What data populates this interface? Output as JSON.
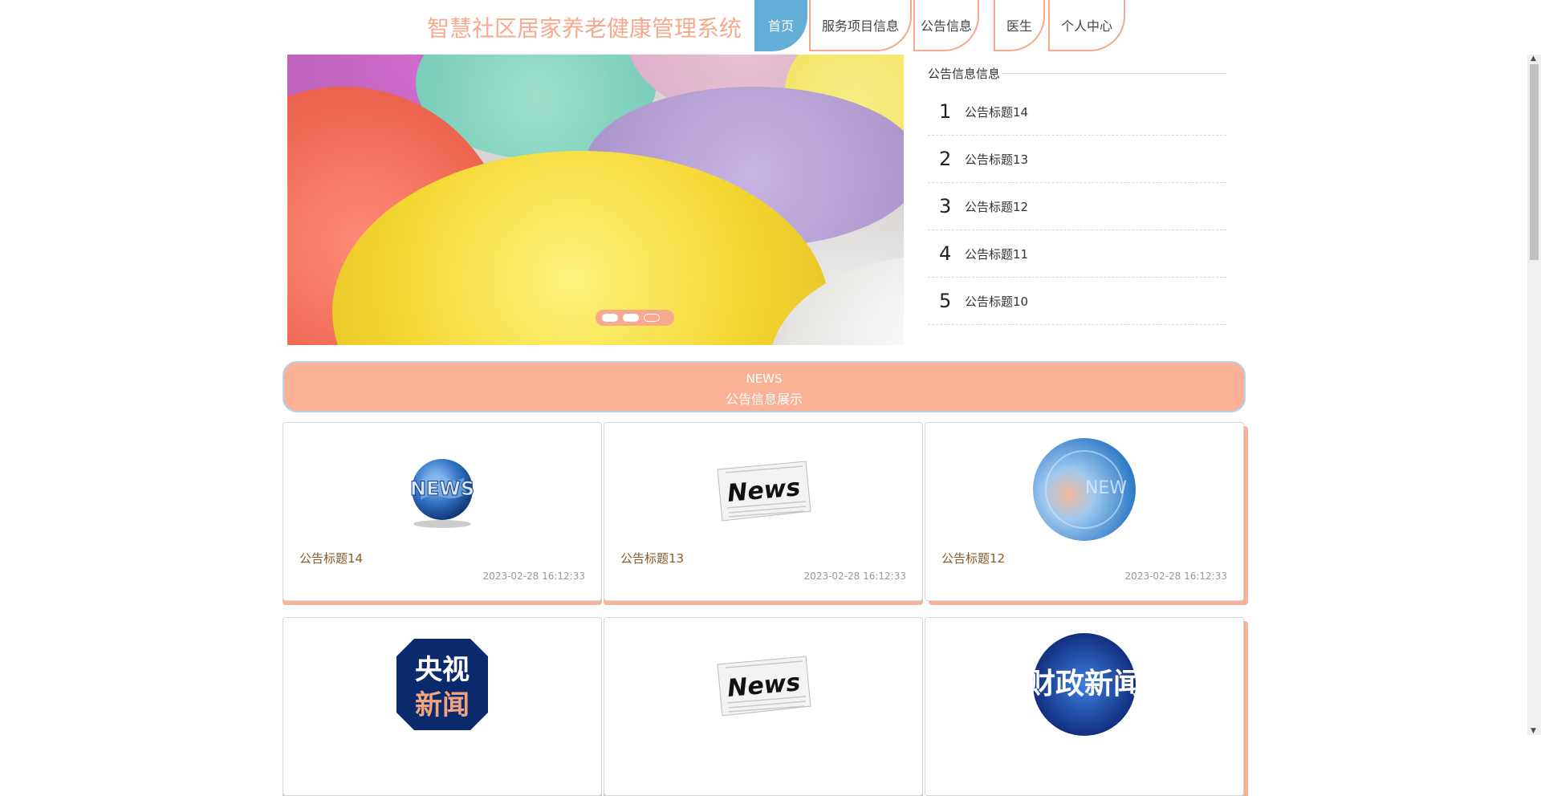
{
  "header": {
    "site_title": "智慧社区居家养老健康管理系统",
    "nav": [
      {
        "label": "首页",
        "active": true
      },
      {
        "label": "服务项目信息",
        "active": false
      },
      {
        "label": "公告信息",
        "active": false
      },
      {
        "label": "医生",
        "active": false
      },
      {
        "label": "个人中心",
        "active": false
      }
    ]
  },
  "carousel": {
    "image_desc": "colorful-eggs-photo",
    "slides": 3,
    "active_slide": 3
  },
  "notice_panel": {
    "heading": "公告信息信息",
    "items": [
      {
        "num": "1",
        "title": "公告标题14"
      },
      {
        "num": "2",
        "title": "公告标题13"
      },
      {
        "num": "3",
        "title": "公告标题12"
      },
      {
        "num": "4",
        "title": "公告标题11"
      },
      {
        "num": "5",
        "title": "公告标题10"
      }
    ]
  },
  "news_banner": {
    "en": "NEWS",
    "cn": "公告信息展示"
  },
  "news_cards": [
    {
      "title": "公告标题14",
      "date": "2023-02-28 16:12:33",
      "icon": "globe-news-icon"
    },
    {
      "title": "公告标题13",
      "date": "2023-02-28 16:12:33",
      "icon": "newspaper-icon"
    },
    {
      "title": "公告标题12",
      "date": "2023-02-28 16:12:33",
      "icon": "digital-globe-icon"
    },
    {
      "title": "",
      "date": "",
      "icon": "cctv-news-logo",
      "logo_text": [
        "央视",
        "新闻"
      ]
    },
    {
      "title": "",
      "date": "",
      "icon": "newspaper-icon"
    },
    {
      "title": "",
      "date": "",
      "icon": "finance-news-logo",
      "logo_text": "财政新闻"
    }
  ],
  "colors": {
    "accent": "#f6a98e",
    "active_nav": "#62aed6",
    "card_title": "#8b5a2b"
  }
}
